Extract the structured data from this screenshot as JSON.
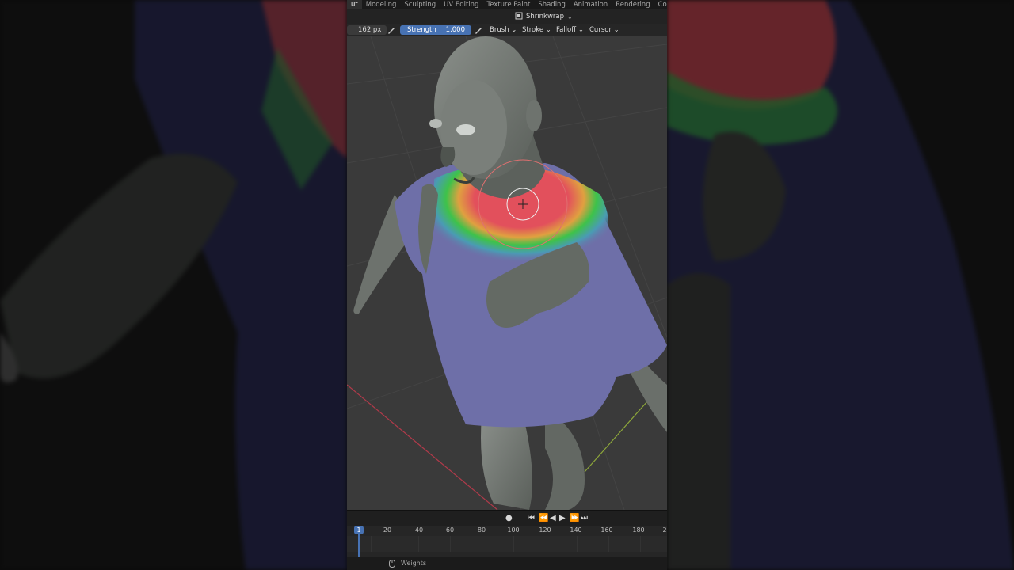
{
  "top_menu": {
    "tabs": [
      "ut",
      "Modeling",
      "Sculpting",
      "UV Editing",
      "Texture Paint",
      "Shading",
      "Animation",
      "Rendering",
      "Compositing"
    ],
    "active_index": 0
  },
  "header": {
    "mode_label": "Shrinkwrap",
    "mode_icon": "object-mode-icon"
  },
  "toolbar": {
    "radius_value": "162 px",
    "strength_label": "Strength",
    "strength_value": "1.000",
    "brush_label": "Brush",
    "stroke_label": "Stroke",
    "falloff_label": "Falloff",
    "cursor_label": "Cursor"
  },
  "playback": {
    "icons": [
      "record-icon",
      "jump-start-icon",
      "prev-keyframe-icon",
      "play-reverse-icon",
      "play-icon",
      "next-keyframe-icon",
      "jump-end-icon"
    ]
  },
  "timeline": {
    "current_frame": "1",
    "ticks": [
      "20",
      "40",
      "60",
      "80",
      "100",
      "120",
      "140",
      "160",
      "180",
      "2"
    ]
  },
  "status": {
    "label": "Weights"
  },
  "colors": {
    "accent": "#4772b3",
    "viewport_bg": "#3a3a3a",
    "shirt": "#6e6fa8",
    "weight_hot": "#e2505c",
    "weight_mid": "#3ec24a"
  }
}
